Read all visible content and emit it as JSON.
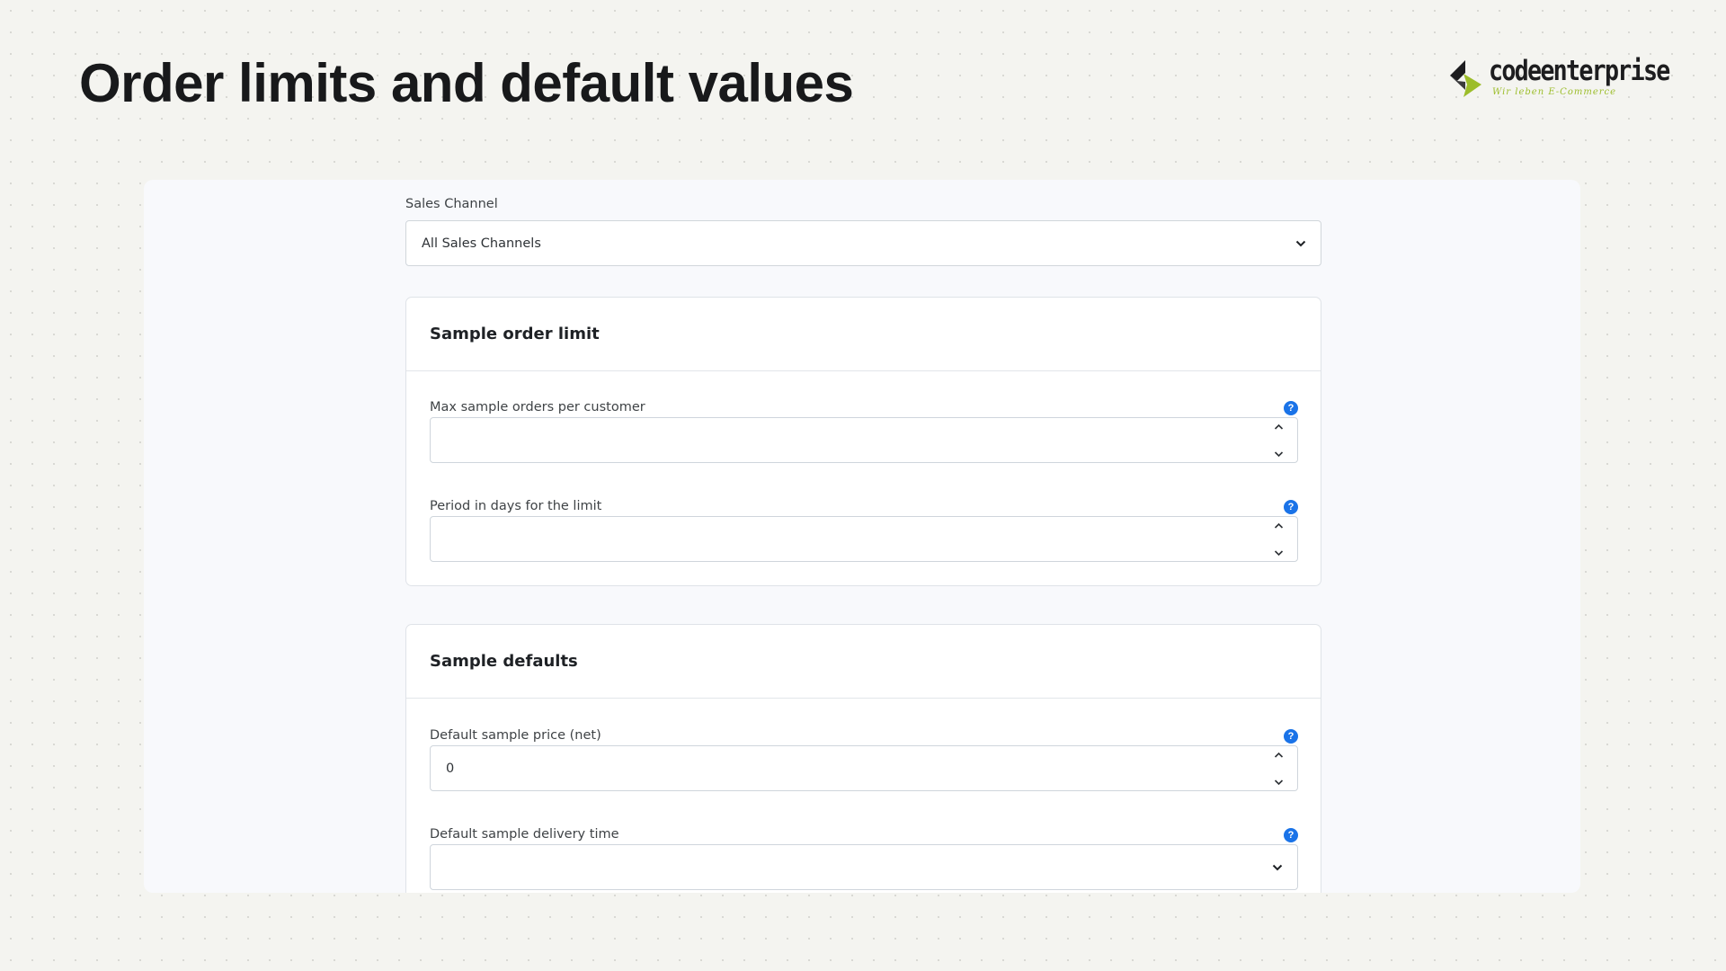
{
  "slide": {
    "title": "Order limits and default values"
  },
  "logo": {
    "name": "codeenterprise",
    "tagline": "Wir leben E-Commerce",
    "colors": {
      "dark": "#1d1d1f",
      "accent": "#9cbd2a"
    }
  },
  "form": {
    "sales_channel": {
      "label": "Sales Channel",
      "value": "All Sales Channels"
    },
    "sample_order_limit": {
      "title": "Sample order limit",
      "fields": [
        {
          "label": "Max sample orders per customer",
          "value": "",
          "type": "number",
          "help_icon": "question-icon"
        },
        {
          "label": "Period in days for the limit",
          "value": "",
          "type": "number",
          "help_icon": "question-icon"
        }
      ]
    },
    "sample_defaults": {
      "title": "Sample defaults",
      "fields": [
        {
          "label": "Default sample price (net)",
          "value": "0",
          "type": "number",
          "help_icon": "question-icon"
        },
        {
          "label": "Default sample delivery time",
          "value": "",
          "type": "select",
          "help_icon": "question-icon"
        }
      ]
    }
  },
  "colors": {
    "help_icon": "#1a73e8",
    "panel_bg": "#f8f9fc",
    "page_bg": "#f4f4f0"
  }
}
